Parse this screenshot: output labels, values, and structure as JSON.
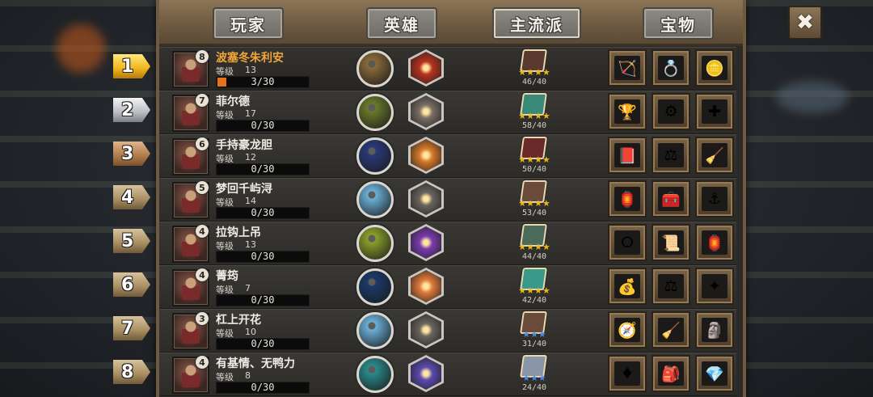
{
  "tabs": {
    "players": "玩家",
    "heroes": "英雄",
    "mainstream": "主流派",
    "treasures": "宝物"
  },
  "close_label": "✖",
  "level_label": "等级",
  "colors": {
    "highlight_name": "#f2a63a",
    "progress_fill": "#e4731b",
    "star_gold": "#e8b91c",
    "star_blue": "#4a8ae0"
  },
  "rows": [
    {
      "rank": "1",
      "rank_style": "gold",
      "name": "波塞冬朱利安",
      "highlight": true,
      "badge": "8",
      "level": "13",
      "progress": "3/30",
      "progress_fraction": 0.1,
      "hero_color": "#8a6a3a",
      "hex_color": "#b8321c",
      "book_color": "#5a3a2e",
      "stars": "★★★★",
      "star_color": "gold",
      "score": "46/40",
      "items": [
        "crossbow-icon",
        "ring-icon",
        "gold-coin-icon"
      ]
    },
    {
      "rank": "2",
      "rank_style": "silver",
      "name": "菲尔德",
      "highlight": false,
      "badge": "7",
      "level": "17",
      "progress": "0/30",
      "progress_fraction": 0,
      "hero_color": "#6a7a2a",
      "hex_color": "#7a7066",
      "book_color": "#3a8a7a",
      "stars": "★★★★",
      "star_color": "gold",
      "score": "58/40",
      "items": [
        "goblet-icon",
        "wheel-icon",
        "medkit-icon"
      ]
    },
    {
      "rank": "3",
      "rank_style": "bronze",
      "name": "手持豪龙胆",
      "highlight": false,
      "badge": "6",
      "level": "12",
      "progress": "0/30",
      "progress_fraction": 0,
      "hero_color": "#2a3a7a",
      "hex_color": "#d87a2a",
      "book_color": "#6a2a2a",
      "stars": "★★★★",
      "star_color": "gold",
      "score": "50/40",
      "items": [
        "spellbook-icon",
        "scales-icon",
        "broom-icon"
      ]
    },
    {
      "rank": "4",
      "rank_style": "stone",
      "name": "梦回千屿浔",
      "highlight": false,
      "badge": "5",
      "level": "14",
      "progress": "0/30",
      "progress_fraction": 0,
      "hero_color": "#6ab0d8",
      "hex_color": "#6a645c",
      "book_color": "#6a4a3a",
      "stars": "★★★★",
      "star_color": "gold",
      "score": "53/40",
      "items": [
        "lantern-icon",
        "chest-icon",
        "anchor-icon"
      ]
    },
    {
      "rank": "5",
      "rank_style": "stone",
      "name": "拉钩上吊",
      "highlight": false,
      "badge": "4",
      "level": "13",
      "progress": "0/30",
      "progress_fraction": 0,
      "hero_color": "#8aa02a",
      "hex_color": "#7a3ab0",
      "book_color": "#4a6a5a",
      "stars": "★★★★",
      "star_color": "gold",
      "score": "44/40",
      "items": [
        "bracelet-icon",
        "scroll-icon",
        "lantern-icon"
      ]
    },
    {
      "rank": "6",
      "rank_style": "stone",
      "name": "菁筠",
      "highlight": false,
      "badge": "4",
      "level": "7",
      "progress": "0/30",
      "progress_fraction": 0,
      "hero_color": "#1a3a6a",
      "hex_color": "#e07a3a",
      "book_color": "#3a9a8a",
      "stars": "★★★★",
      "star_color": "gold",
      "score": "42/40",
      "items": [
        "treasure-chest-icon",
        "scales-icon",
        "staff-icon"
      ]
    },
    {
      "rank": "7",
      "rank_style": "stone",
      "name": "杠上开花",
      "highlight": false,
      "badge": "3",
      "level": "10",
      "progress": "0/30",
      "progress_fraction": 0,
      "hero_color": "#6ab0d8",
      "hex_color": "#6a645c",
      "book_color": "#6a4a3a",
      "stars": "★★★",
      "star_color": "blue",
      "score": "31/40",
      "items": [
        "compass-icon",
        "broom-icon",
        "statue-icon"
      ]
    },
    {
      "rank": "8",
      "rank_style": "stone",
      "name": "有基情、无鸭力",
      "highlight": false,
      "badge": "4",
      "level": "8",
      "progress": "0/30",
      "progress_fraction": 0,
      "hero_color": "#2a8a8a",
      "hex_color": "#5a4ab0",
      "book_color": "#8a96a8",
      "stars": "★★★",
      "star_color": "blue",
      "score": "24/40",
      "items": [
        "red-gem-icon",
        "backpack-icon",
        "blue-crystal-icon"
      ]
    }
  ],
  "item_glyphs": {
    "crossbow-icon": "🏹",
    "ring-icon": "💍",
    "gold-coin-icon": "🪙",
    "goblet-icon": "🏆",
    "wheel-icon": "⚙",
    "medkit-icon": "✚",
    "spellbook-icon": "📕",
    "scales-icon": "⚖",
    "broom-icon": "🧹",
    "lantern-icon": "🏮",
    "chest-icon": "🧰",
    "anchor-icon": "⚓",
    "bracelet-icon": "⭘",
    "scroll-icon": "📜",
    "treasure-chest-icon": "💰",
    "staff-icon": "✦",
    "compass-icon": "🧭",
    "statue-icon": "🗿",
    "red-gem-icon": "♦",
    "backpack-icon": "🎒",
    "blue-crystal-icon": "💎"
  }
}
